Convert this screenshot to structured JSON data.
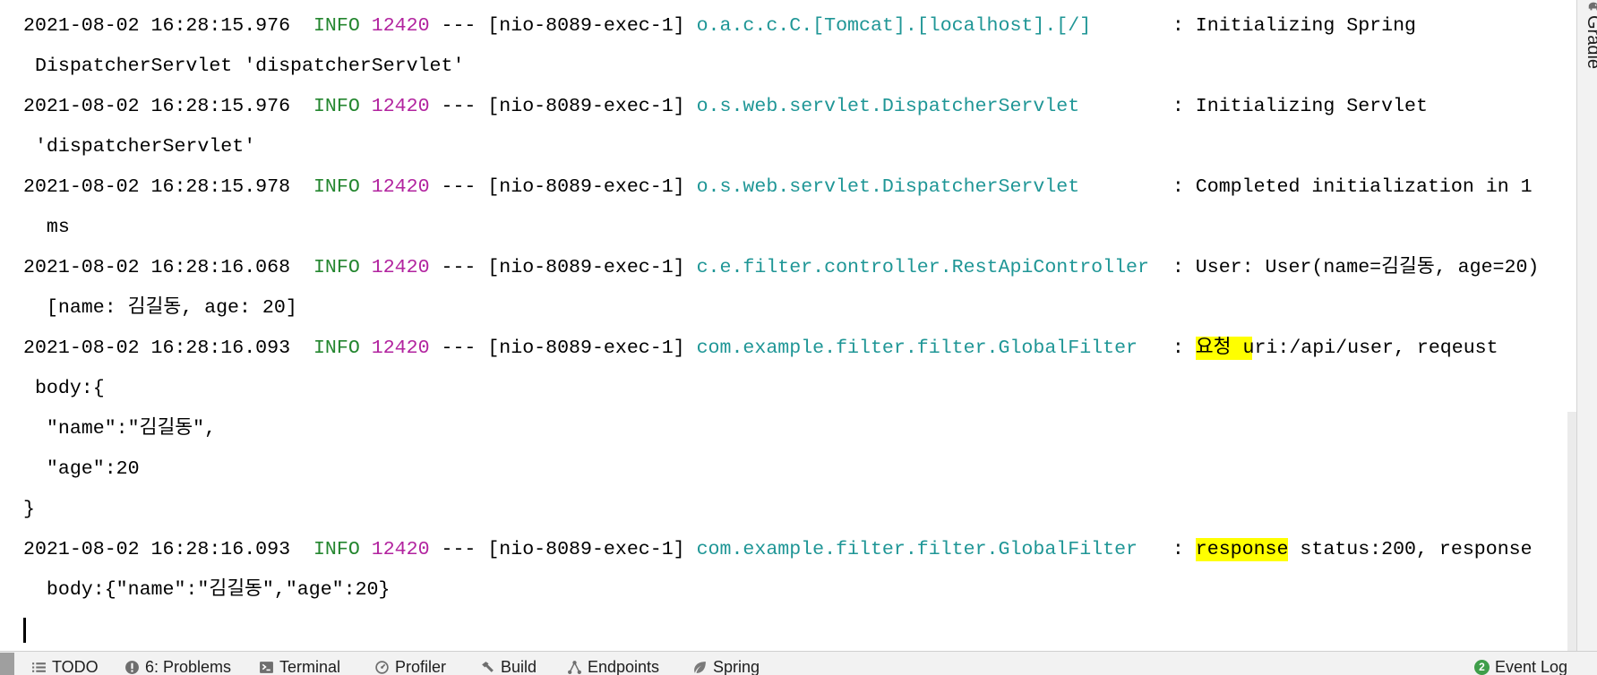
{
  "console": {
    "entries": [
      {
        "timestamp": "2021-08-02 16:28:15.976",
        "level": "INFO",
        "pid": "12420",
        "separator": "---",
        "thread": "[nio-8089-exec-1]",
        "logger": "o.a.c.c.C.[Tomcat].[localhost].[/]",
        "colon": ":",
        "message": [
          {
            "text": "Initializing Spring",
            "highlighted": false
          }
        ],
        "continuation": [
          "DispatcherServlet 'dispatcherServlet'"
        ]
      },
      {
        "timestamp": "2021-08-02 16:28:15.976",
        "level": "INFO",
        "pid": "12420",
        "separator": "---",
        "thread": "[nio-8089-exec-1]",
        "logger": "o.s.web.servlet.DispatcherServlet",
        "colon": ":",
        "message": [
          {
            "text": "Initializing Servlet",
            "highlighted": false
          }
        ],
        "continuation": [
          "'dispatcherServlet'"
        ]
      },
      {
        "timestamp": "2021-08-02 16:28:15.978",
        "level": "INFO",
        "pid": "12420",
        "separator": "---",
        "thread": "[nio-8089-exec-1]",
        "logger": "o.s.web.servlet.DispatcherServlet",
        "colon": ":",
        "message": [
          {
            "text": "Completed initialization in 1",
            "highlighted": false
          }
        ],
        "continuation": [
          "ms"
        ]
      },
      {
        "timestamp": "2021-08-02 16:28:16.068",
        "level": "INFO",
        "pid": "12420",
        "separator": "---",
        "thread": "[nio-8089-exec-1]",
        "logger": "c.e.filter.controller.RestApiController",
        "colon": ":",
        "message": [
          {
            "text": "User: User(name=김길동, age=20)",
            "highlighted": false
          }
        ],
        "continuation": [
          "[name: 김길동, age: 20]"
        ]
      },
      {
        "timestamp": "2021-08-02 16:28:16.093",
        "level": "INFO",
        "pid": "12420",
        "separator": "---",
        "thread": "[nio-8089-exec-1]",
        "logger": "com.example.filter.filter.GlobalFilter",
        "colon": ":",
        "message": [
          {
            "text": "요청 ",
            "highlighted": true
          },
          {
            "text": "uri:/api/user, reqeust",
            "highlighted": false
          }
        ],
        "continuation": [
          "body:{",
          "\"name\":\"김길동\",",
          "\"age\":20",
          "}"
        ]
      },
      {
        "timestamp": "2021-08-02 16:28:16.093",
        "level": "INFO",
        "pid": "12420",
        "separator": "---",
        "thread": "[nio-8089-exec-1]",
        "logger": "com.example.filter.filter.GlobalFilter",
        "colon": ":",
        "message": [
          {
            "text": "response",
            "highlighted": true
          },
          {
            "text": " status:200, response",
            "highlighted": false
          }
        ],
        "continuation": [
          "body:{\"name\":\"김길동\",\"age\":20}"
        ]
      }
    ]
  },
  "toolbar": {
    "items": [
      {
        "label": "TODO",
        "icon": "todo-list-icon"
      },
      {
        "label": "6: Problems",
        "icon": "problems-icon"
      },
      {
        "label": "Terminal",
        "icon": "terminal-icon"
      },
      {
        "label": "Profiler",
        "icon": "profiler-icon"
      },
      {
        "label": "Build",
        "icon": "build-hammer-icon"
      },
      {
        "label": "Endpoints",
        "icon": "endpoints-icon"
      },
      {
        "label": "Spring",
        "icon": "spring-leaf-icon"
      }
    ],
    "event_log": {
      "label": "Event Log",
      "badge_count": "2",
      "icon": "event-log-badge-icon"
    }
  },
  "side_panel": {
    "label": "Gradle",
    "icon": "gradle-elephant-icon"
  },
  "colors": {
    "text": "#000000",
    "level_info": "#24862f",
    "pid": "#b2239f",
    "logger": "#1f9696",
    "highlight": "#ffff00",
    "badge": "#3f9e4a"
  }
}
